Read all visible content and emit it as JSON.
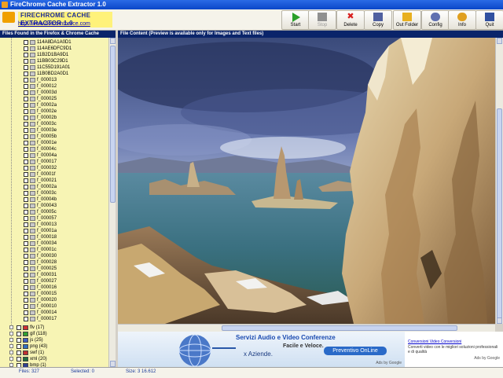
{
  "window": {
    "title": "FireChrome Cache Extractor 1.0"
  },
  "logo": {
    "name": "FIRECHROME CACHE EXTRACTOR 1.0",
    "url": "http://www.dotcommerce.com"
  },
  "toolbar": [
    {
      "label": "Start",
      "icon": "play-icon",
      "color": "#2aa02a",
      "enabled": true
    },
    {
      "label": "Stop",
      "icon": "stop-icon",
      "color": "#909090",
      "enabled": false
    },
    {
      "label": "Delete",
      "icon": "delete-x-icon",
      "color": "#d82020",
      "enabled": true
    },
    {
      "label": "Copy",
      "icon": "copy-icon",
      "color": "#5060a0",
      "enabled": true
    },
    {
      "label": "Out Folder",
      "icon": "folder-icon",
      "color": "#e8b020",
      "enabled": true
    },
    {
      "label": "Config",
      "icon": "gear-icon",
      "color": "#6070b0",
      "enabled": true
    },
    {
      "label": "Info",
      "icon": "info-icon",
      "color": "#e0a020",
      "enabled": true
    },
    {
      "label": "Quit",
      "icon": "exit-door-icon",
      "color": "#3050a0",
      "enabled": true
    }
  ],
  "left_pane": {
    "header": "Files Found in the Firefox & Chrome Cache",
    "hash_items": [
      "114A8DA1A0D1",
      "114AE6DFC9D1",
      "11B2D1BA9D1",
      "11BB03C29D1",
      "11C55D191A01",
      "11B0BD2A0D1"
    ],
    "files": [
      "f_000013",
      "f_000012",
      "f_00003d",
      "f_000025",
      "f_00002a",
      "f_00002e",
      "f_00002b",
      "f_00003c",
      "f_00003e",
      "f_00005b",
      "f_00001e",
      "f_00004c",
      "f_00004a",
      "f_000017",
      "f_000032",
      "f_00001f",
      "f_000021",
      "f_00002a",
      "f_00003c",
      "f_00004b",
      "f_000043",
      "f_00005c",
      "f_000057",
      "f_000013",
      "f_00001a",
      "f_000018",
      "f_000034",
      "f_00001c",
      "f_000030",
      "f_000028",
      "f_000025",
      "f_000031",
      "f_000027",
      "f_000016",
      "f_000015",
      "f_000020",
      "f_000010",
      "f_000014",
      "f_000017"
    ],
    "categories": [
      {
        "label": "flv (17)",
        "icon": "flash-icon",
        "color": "#d03030"
      },
      {
        "label": "gif (118)",
        "icon": "gif-icon",
        "color": "#30a030"
      },
      {
        "label": "js (25)",
        "icon": "script-icon",
        "color": "#4060c0"
      },
      {
        "label": "png (43)",
        "icon": "png-icon",
        "color": "#3070c0"
      },
      {
        "label": "swf (1)",
        "icon": "swf-icon",
        "color": "#c03030"
      },
      {
        "label": "xml (20)",
        "icon": "xml-icon",
        "color": "#207040"
      },
      {
        "label": "bmp (1)",
        "icon": "bmp-icon",
        "color": "#304090"
      },
      {
        "label": "htm (26)",
        "icon": "html-icon",
        "color": "#2050a0"
      }
    ]
  },
  "right_pane": {
    "header": "File Content (Preview is available only for Images and Text files)"
  },
  "ad": {
    "headline": "Servizi Audio e Video Conferenze",
    "line1": "Facile e Veloce.",
    "line2": "x Aziende.",
    "button": "Preventivo OnLine",
    "adsby": "Ads by Google"
  },
  "ad2": {
    "link": "Conversioni Video Conversioni",
    "text": "Converti video con le migliori soluzioni professionali e di qualità",
    "adsby": "Ads by Google"
  },
  "status": {
    "files": "Files: 327",
    "selected": "Selected: 0",
    "size": "Size: 3 16.612"
  }
}
